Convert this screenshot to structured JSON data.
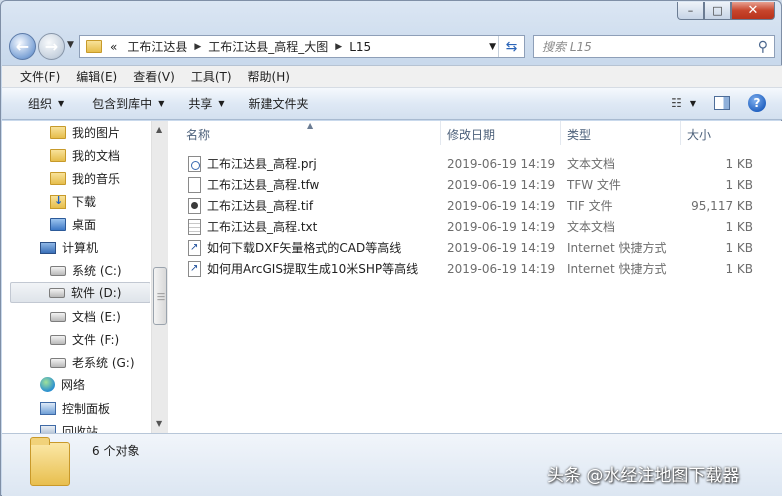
{
  "window": {
    "min_label": "–",
    "max_label": "□",
    "close_label": "✕"
  },
  "address": {
    "overflow": "«",
    "crumbs": [
      "工布江达县",
      "工布江达县_高程_大图",
      "L15"
    ]
  },
  "search": {
    "placeholder": "搜索 L15"
  },
  "menu": [
    "文件(F)",
    "编辑(E)",
    "查看(V)",
    "工具(T)",
    "帮助(H)"
  ],
  "commands": [
    "组织",
    "包含到库中",
    "共享",
    "新建文件夹"
  ],
  "sidebar": {
    "items": [
      {
        "label": "我的图片",
        "icon": "folder-icon"
      },
      {
        "label": "我的文档",
        "icon": "folder-icon"
      },
      {
        "label": "我的音乐",
        "icon": "folder-icon"
      },
      {
        "label": "下载",
        "icon": "download-folder-icon"
      },
      {
        "label": "桌面",
        "icon": "folder-icon"
      },
      {
        "label": "计算机",
        "icon": "computer-icon"
      },
      {
        "label": "系统 (C:)",
        "icon": "drive-icon"
      },
      {
        "label": "软件 (D:)",
        "icon": "drive-icon"
      },
      {
        "label": "文档 (E:)",
        "icon": "drive-icon"
      },
      {
        "label": "文件 (F:)",
        "icon": "drive-icon"
      },
      {
        "label": "老系统 (G:)",
        "icon": "drive-icon"
      },
      {
        "label": "网络",
        "icon": "network-icon"
      },
      {
        "label": "控制面板",
        "icon": "control-panel-icon"
      },
      {
        "label": "回收站",
        "icon": "recycle-bin-icon"
      }
    ]
  },
  "columns": {
    "name": "名称",
    "modified": "修改日期",
    "type": "类型",
    "size": "大小"
  },
  "files": [
    {
      "name": "工布江达县_高程.prj",
      "modified": "2019-06-19 14:19",
      "type": "文本文档",
      "size": "1 KB",
      "icon": "prj"
    },
    {
      "name": "工布江达县_高程.tfw",
      "modified": "2019-06-19 14:19",
      "type": "TFW 文件",
      "size": "1 KB",
      "icon": "tfw"
    },
    {
      "name": "工布江达县_高程.tif",
      "modified": "2019-06-19 14:19",
      "type": "TIF 文件",
      "size": "95,117 KB",
      "icon": "tif"
    },
    {
      "name": "工布江达县_高程.txt",
      "modified": "2019-06-19 14:19",
      "type": "文本文档",
      "size": "1 KB",
      "icon": "txt"
    },
    {
      "name": "如何下载DXF矢量格式的CAD等高线",
      "modified": "2019-06-19 14:19",
      "type": "Internet 快捷方式",
      "size": "1 KB",
      "icon": "url"
    },
    {
      "name": "如何用ArcGIS提取生成10米SHP等高线",
      "modified": "2019-06-19 14:19",
      "type": "Internet 快捷方式",
      "size": "1 KB",
      "icon": "url"
    }
  ],
  "status": {
    "count": "6 个对象"
  },
  "watermark": "头条 @水经注地图下载器"
}
